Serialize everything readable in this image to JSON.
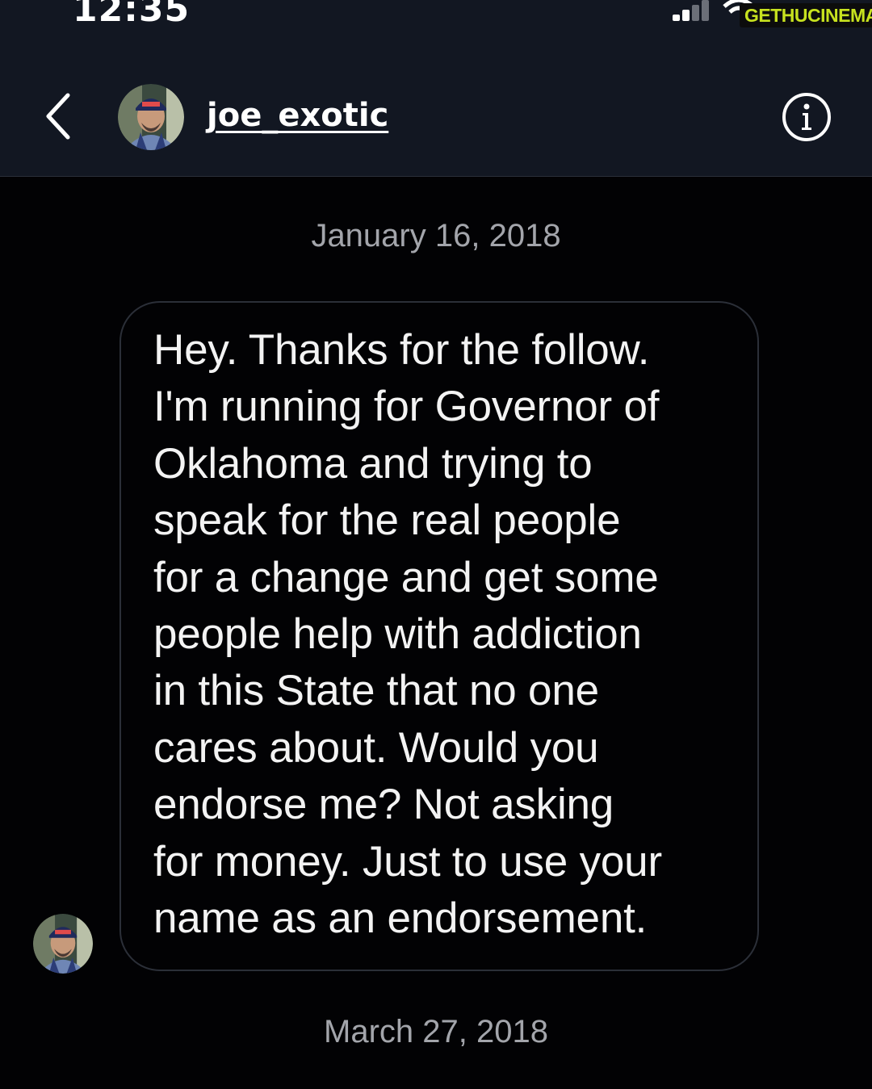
{
  "status_bar": {
    "time": "12:35",
    "watermark": "GETHUCINEMA",
    "signal_icon": "cellular-signal-icon",
    "wifi_icon": "wifi-icon"
  },
  "header": {
    "back_icon": "chevron-left-icon",
    "username": "joe_exotic",
    "info_icon": "info-icon"
  },
  "messages": [
    {
      "date": "January 16, 2018",
      "text": "Hey. Thanks for the follow.\nI'm running for Governor of\nOklahoma and trying to\nspeak for the real people\nfor a change and get some\npeople help with addiction\nin this State that no one\ncares about. Would you\nendorse me? Not asking\nfor money. Just to use your\nname as an endorsement."
    }
  ],
  "next_date": "March 27, 2018",
  "colors": {
    "header_bg": "#121722",
    "background": "#020204",
    "bubble_border": "#2b2f38",
    "date_text": "#a3a5ab",
    "watermark": "#c7e21f"
  }
}
